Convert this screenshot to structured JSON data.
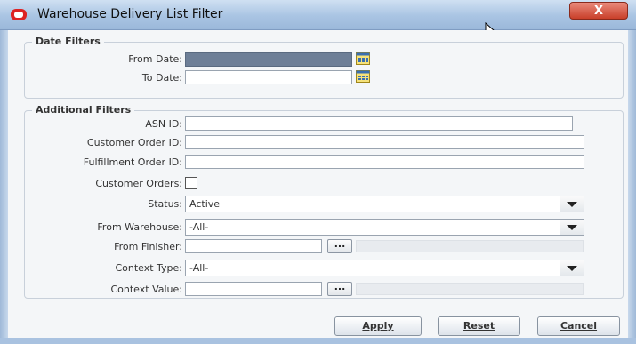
{
  "window": {
    "title": "Warehouse Delivery List Filter",
    "close_label": "X"
  },
  "date_filters": {
    "legend": "Date Filters",
    "from_date": {
      "label": "From Date:",
      "value": ""
    },
    "to_date": {
      "label": "To Date:",
      "value": ""
    }
  },
  "additional_filters": {
    "legend": "Additional Filters",
    "asn_id": {
      "label": "ASN ID:",
      "value": ""
    },
    "customer_order_id": {
      "label": "Customer Order ID:",
      "value": ""
    },
    "fulfillment_order_id": {
      "label": "Fulfillment Order ID:",
      "value": ""
    },
    "customer_orders": {
      "label": "Customer Orders:",
      "checked": false
    },
    "status": {
      "label": "Status:",
      "value": "Active"
    },
    "from_warehouse": {
      "label": "From Warehouse:",
      "value": "-All-"
    },
    "from_finisher": {
      "label": "From Finisher:",
      "value": "",
      "lookup": "..."
    },
    "context_type": {
      "label": "Context Type:",
      "value": "-All-"
    },
    "context_value": {
      "label": "Context Value:",
      "value": "",
      "lookup": "..."
    }
  },
  "buttons": {
    "apply": "Apply",
    "reset": "Reset",
    "cancel": "Cancel"
  },
  "colors": {
    "title_bar": "#a9c4e3",
    "close_button": "#c9402a",
    "selected_field": "#6e7f97"
  }
}
